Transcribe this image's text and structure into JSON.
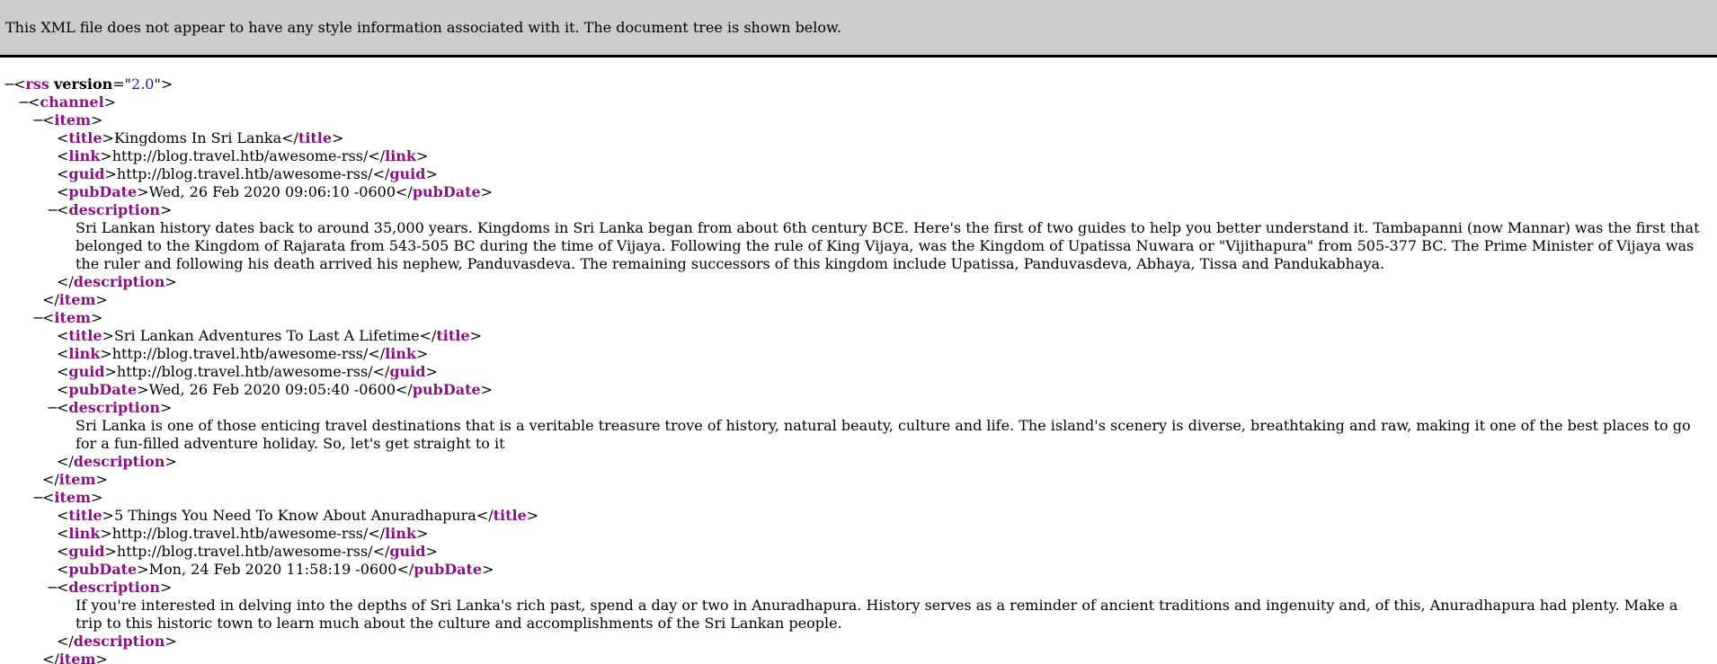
{
  "header": {
    "notice": "This XML file does not appear to have any style information associated with it. The document tree is shown below."
  },
  "colors": {
    "tag": "#881280",
    "attr_value": "#1a1aa6",
    "header_bg": "#cccccc"
  },
  "icons": {
    "collapse": "collapse-toggle-icon"
  },
  "rss": {
    "open_name": "rss",
    "attr_name": "version",
    "attr_value": "2.0",
    "channel_name": "channel"
  },
  "items": [
    {
      "title": "Kingdoms In Sri Lanka",
      "link": "http://blog.travel.htb/awesome-rss/",
      "guid": "http://blog.travel.htb/awesome-rss/",
      "pubDate": "Wed, 26 Feb 2020 09:06:10 -0600",
      "description": "Sri Lankan history dates back to around 35,000 years. Kingdoms in Sri Lanka began from about 6th century BCE. Here's the first of two guides to help you better understand it. Tambapanni (now Mannar) was the first that belonged to the Kingdom of Rajarata from 543-505 BC during the time of Vijaya. Following the rule of King Vijaya, was the Kingdom of Upatissa Nuwara or \"Vijithapura\" from 505-377 BC. The Prime Minister of Vijaya was the ruler and following his death arrived his nephew, Panduvasdeva. The remaining successors of this kingdom include Upatissa, Panduvasdeva, Abhaya, Tissa and Pandukabhaya."
    },
    {
      "title": "Sri Lankan Adventures To Last A Lifetime",
      "link": "http://blog.travel.htb/awesome-rss/",
      "guid": "http://blog.travel.htb/awesome-rss/",
      "pubDate": "Wed, 26 Feb 2020 09:05:40 -0600",
      "description": "Sri Lanka is one of those enticing travel destinations that is a veritable treasure trove of history, natural beauty, culture and life. The island's scenery is diverse, breathtaking and raw, making it one of the best places to go for a fun-filled adventure holiday. So, let's get straight to it"
    },
    {
      "title": "5 Things You Need To Know About Anuradhapura",
      "link": "http://blog.travel.htb/awesome-rss/",
      "guid": "http://blog.travel.htb/awesome-rss/",
      "pubDate": "Mon, 24 Feb 2020 11:58:19 -0600",
      "description": "If you're interested in delving into the depths of Sri Lanka's rich past, spend a day or two in Anuradhapura. History serves as a reminder of ancient traditions and ingenuity and, of this, Anuradhapura had plenty. Make a trip to this historic town to learn much about the culture and accomplishments of the Sri Lankan people."
    }
  ],
  "tags": {
    "item": "item",
    "title": "title",
    "link": "link",
    "guid": "guid",
    "pubDate": "pubDate",
    "description": "description"
  }
}
